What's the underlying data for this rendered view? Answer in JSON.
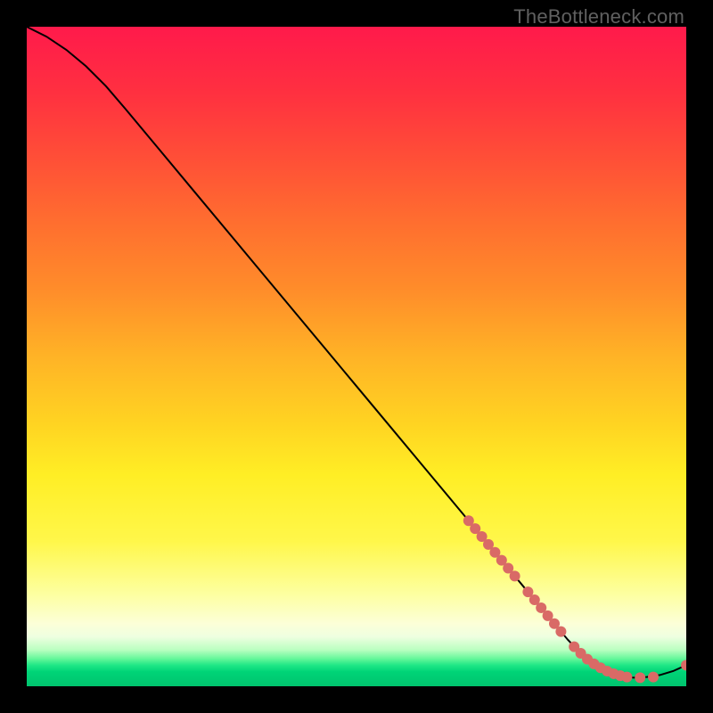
{
  "watermark": "TheBottleneck.com",
  "colors": {
    "curve": "#000000",
    "marker_fill": "#d96a66",
    "marker_stroke": "#c05a56",
    "gradient_stops": [
      {
        "offset": 0.0,
        "color": "#ff1a4b"
      },
      {
        "offset": 0.1,
        "color": "#ff3040"
      },
      {
        "offset": 0.2,
        "color": "#ff4f37"
      },
      {
        "offset": 0.3,
        "color": "#ff6f2f"
      },
      {
        "offset": 0.4,
        "color": "#ff8d2a"
      },
      {
        "offset": 0.5,
        "color": "#ffb326"
      },
      {
        "offset": 0.6,
        "color": "#ffd322"
      },
      {
        "offset": 0.68,
        "color": "#ffee25"
      },
      {
        "offset": 0.78,
        "color": "#fff74a"
      },
      {
        "offset": 0.86,
        "color": "#fdffa0"
      },
      {
        "offset": 0.905,
        "color": "#fcffd8"
      },
      {
        "offset": 0.925,
        "color": "#eeffe0"
      },
      {
        "offset": 0.945,
        "color": "#b9ffc0"
      },
      {
        "offset": 0.958,
        "color": "#66f79a"
      },
      {
        "offset": 0.968,
        "color": "#20e786"
      },
      {
        "offset": 0.978,
        "color": "#00d477"
      },
      {
        "offset": 1.0,
        "color": "#00c46e"
      }
    ]
  },
  "chart_data": {
    "type": "line",
    "title": "",
    "xlabel": "",
    "ylabel": "",
    "xlim": [
      0,
      100
    ],
    "ylim": [
      0,
      100
    ],
    "series": [
      {
        "name": "bottleneck-curve",
        "x": [
          0,
          3,
          6,
          9,
          12,
          15,
          20,
          25,
          30,
          35,
          40,
          45,
          50,
          55,
          60,
          65,
          70,
          75,
          80,
          82,
          84,
          86,
          88,
          90,
          92,
          94,
          96,
          98,
          100
        ],
        "y": [
          100,
          98.5,
          96.5,
          94,
          91,
          87.5,
          81.5,
          75.5,
          69.5,
          63.5,
          57.5,
          51.5,
          45.5,
          39.5,
          33.5,
          27.5,
          21.5,
          15.5,
          9.5,
          7.1,
          5.0,
          3.4,
          2.3,
          1.6,
          1.3,
          1.4,
          1.7,
          2.3,
          3.2
        ]
      }
    ],
    "markers": {
      "name": "sample-points",
      "x": [
        67,
        68,
        69,
        70,
        71,
        72,
        73,
        74,
        76,
        77,
        78,
        79,
        80,
        81,
        83,
        84,
        85,
        86,
        87,
        88,
        89,
        90,
        91,
        93,
        95,
        100
      ],
      "y": [
        25.1,
        23.9,
        22.7,
        21.5,
        20.3,
        19.1,
        17.9,
        16.7,
        14.3,
        13.1,
        11.9,
        10.7,
        9.5,
        8.3,
        6.0,
        5.0,
        4.1,
        3.4,
        2.8,
        2.3,
        1.9,
        1.6,
        1.4,
        1.3,
        1.4,
        3.2
      ]
    }
  }
}
